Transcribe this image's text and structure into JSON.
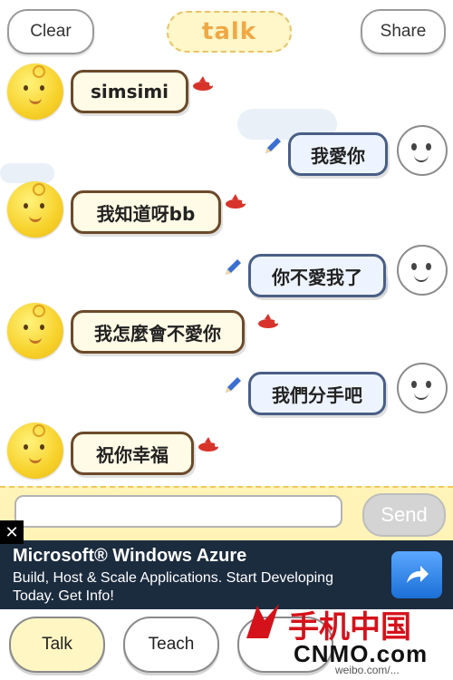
{
  "header": {
    "clear_label": "Clear",
    "title": "talk",
    "share_label": "Share"
  },
  "messages": [
    {
      "side": "left",
      "text": "simsimi"
    },
    {
      "side": "right",
      "text": "我愛你"
    },
    {
      "side": "left",
      "text": "我知道呀bb"
    },
    {
      "side": "right",
      "text": "你不愛我了"
    },
    {
      "side": "left",
      "text": "我怎麼會不愛你"
    },
    {
      "side": "right",
      "text": "我們分手吧"
    },
    {
      "side": "left",
      "text": "祝你幸福"
    }
  ],
  "input": {
    "value": "",
    "send_label": "Send"
  },
  "ad": {
    "close_label": "✕",
    "title": "Microsoft® Windows Azure",
    "body": "Build, Host & Scale Applications. Start Developing Today. Get Info!"
  },
  "tabs": [
    {
      "label": "Talk",
      "active": true
    },
    {
      "label": "Teach",
      "active": false
    },
    {
      "label": "",
      "active": false
    }
  ],
  "watermark": {
    "cn": "手机中国",
    "en": "CNMO.com",
    "url": "weibo.com/..."
  }
}
